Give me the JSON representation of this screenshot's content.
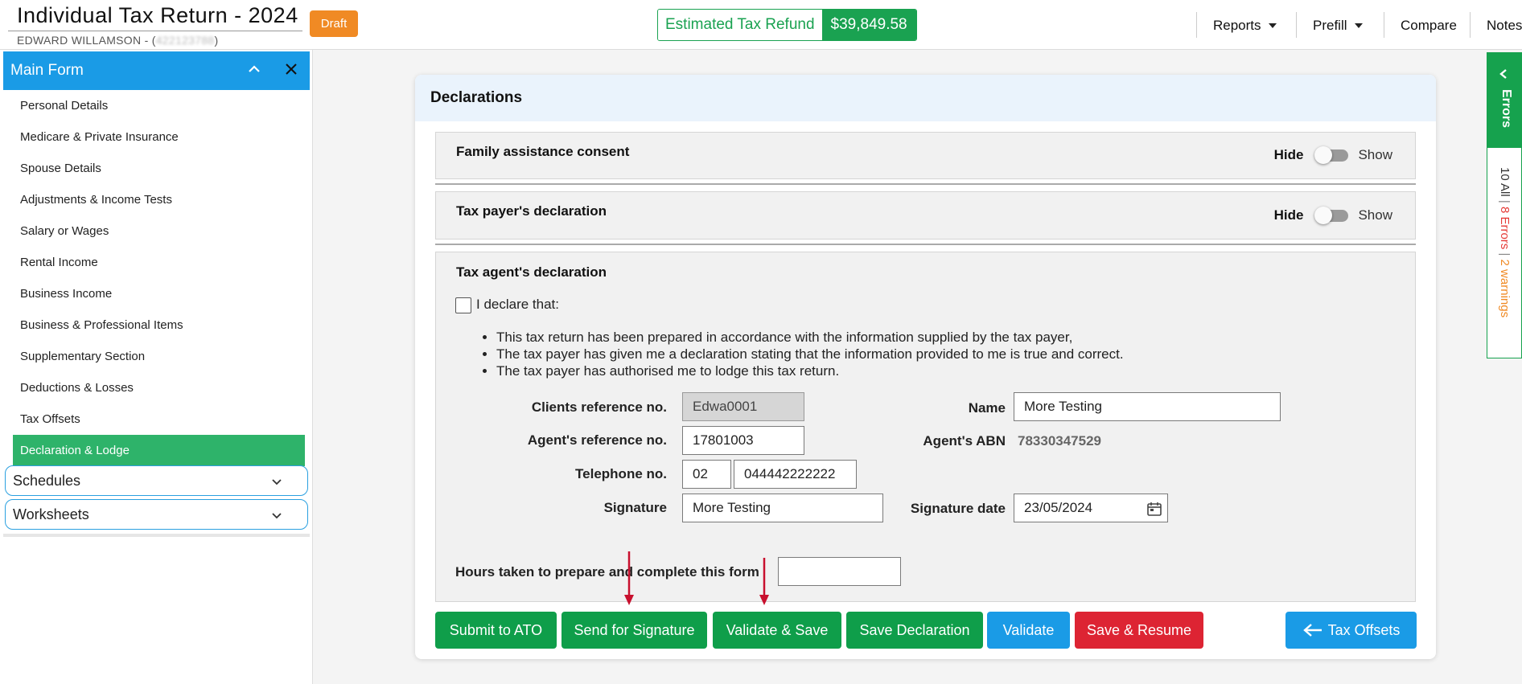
{
  "header": {
    "title": "Individual Tax Return - 2024",
    "client_name": "EDWARD WILLAMSON - (",
    "client_id": "422123788",
    "client_close": ")",
    "status_badge": "Draft",
    "refund_label": "Estimated Tax Refund",
    "refund_value": "$39,849.58",
    "nav": {
      "reports": "Reports",
      "prefill": "Prefill",
      "compare": "Compare",
      "notes": "Notes"
    }
  },
  "sidebar": {
    "main_form_label": "Main Form",
    "items": [
      {
        "label": "Personal Details"
      },
      {
        "label": "Medicare & Private Insurance"
      },
      {
        "label": "Spouse Details"
      },
      {
        "label": "Adjustments & Income Tests"
      },
      {
        "label": "Salary or Wages"
      },
      {
        "label": "Rental Income"
      },
      {
        "label": "Business Income"
      },
      {
        "label": "Business & Professional Items"
      },
      {
        "label": "Supplementary Section"
      },
      {
        "label": "Deductions & Losses"
      },
      {
        "label": "Tax Offsets"
      },
      {
        "label": "Declaration & Lodge"
      }
    ],
    "active_item": "Declaration & Lodge",
    "schedules_label": "Schedules",
    "worksheets_label": "Worksheets"
  },
  "main": {
    "card_title": "Declarations",
    "family_section_title": "Family assistance consent",
    "taxpayer_section_title": "Tax payer's declaration",
    "toggle_hide": "Hide",
    "toggle_show": "Show",
    "agent_section_title": "Tax agent's declaration",
    "declare_label": "I declare that:",
    "declarations": [
      "This tax return has been prepared in accordance with the information supplied by the tax payer,",
      "The tax payer has given me a declaration stating that the information provided to me is true and correct.",
      "The tax payer has authorised me to lodge this tax return."
    ],
    "fields": {
      "clients_ref_label": "Clients reference no.",
      "clients_ref_value": "Edwa0001",
      "agents_ref_label": "Agent's reference no.",
      "agents_ref_value": "17801003",
      "telephone_label": "Telephone no.",
      "telephone_area": "02",
      "telephone_number": "044442222222",
      "signature_label": "Signature",
      "signature_value": "More Testing",
      "name_label": "Name",
      "name_value": "More Testing",
      "abn_label": "Agent's ABN",
      "abn_value": "78330347529",
      "signature_date_label": "Signature date",
      "signature_date_value": "23/05/2024",
      "hours_label": "Hours taken to prepare and complete this form",
      "hours_value": ""
    },
    "buttons": {
      "submit": "Submit to ATO",
      "send_signature": "Send for Signature",
      "validate_save": "Validate & Save",
      "save_declaration": "Save Declaration",
      "validate": "Validate",
      "save_resume": "Save & Resume",
      "tax_offsets": "Tax Offsets"
    }
  },
  "errors_panel": {
    "tab_label": "Errors",
    "all_count": "10 All",
    "errors_count": "8 Errors",
    "warnings_count": "2 warnings",
    "separator": "|"
  },
  "colors": {
    "primary_blue": "#1a9be6",
    "green": "#0f9e4a",
    "red": "#dd2433",
    "orange": "#f08a24",
    "arrow_red": "#c8102e"
  }
}
